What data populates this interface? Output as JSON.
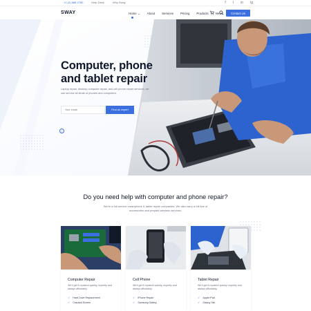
{
  "topbar": {
    "phone": "+1 (2) 888 2780",
    "links": [
      "Help Desk",
      "Why Sway"
    ],
    "social": [
      "f",
      "t",
      "in",
      "ig"
    ]
  },
  "nav": {
    "logo": "SWAY",
    "menu": [
      "Home",
      "About",
      "Services",
      "Pricing",
      "Products",
      "News"
    ],
    "active_arrow": "⌄",
    "cart_icon": "cart-icon",
    "search_icon": "search-icon",
    "contact_label": "Contact Us"
  },
  "hero": {
    "title_line1": "Computer, phone",
    "title_line2": "and tablet repair",
    "subtitle": "Laptop repair, desktop computer repair, and cell phone repair services, we can service all kinds of phones and computers.",
    "email_placeholder": "Your email",
    "button_label": "Find an expert",
    "scroll_icon": "↓"
  },
  "section": {
    "title": "Do you need help with computer and phone repair?",
    "subtitle": "We're a full-service smartphone & tablet repair companies. We also carry a full line of accessories and prepaid wireless services."
  },
  "cards": [
    {
      "title": "Computer Repair",
      "desc": "We'll get it repaired quickly, expertly and always affordably.",
      "items": [
        "Hard Drive Replacement",
        "Cracked Screen"
      ]
    },
    {
      "title": "Cell Phone",
      "desc": "We'll get it repaired quickly, expertly and always affordably.",
      "items": [
        "iPhone Repair",
        "Samsung Galaxy"
      ]
    },
    {
      "title": "Tablet Repair",
      "desc": "We'll get it repaired quickly, expertly and always affordably.",
      "items": [
        "Apple iPad",
        "Galaxy Tab"
      ]
    }
  ],
  "colors": {
    "accent": "#3b6fe0",
    "heading": "#0f172a",
    "muted": "#6b7280"
  }
}
